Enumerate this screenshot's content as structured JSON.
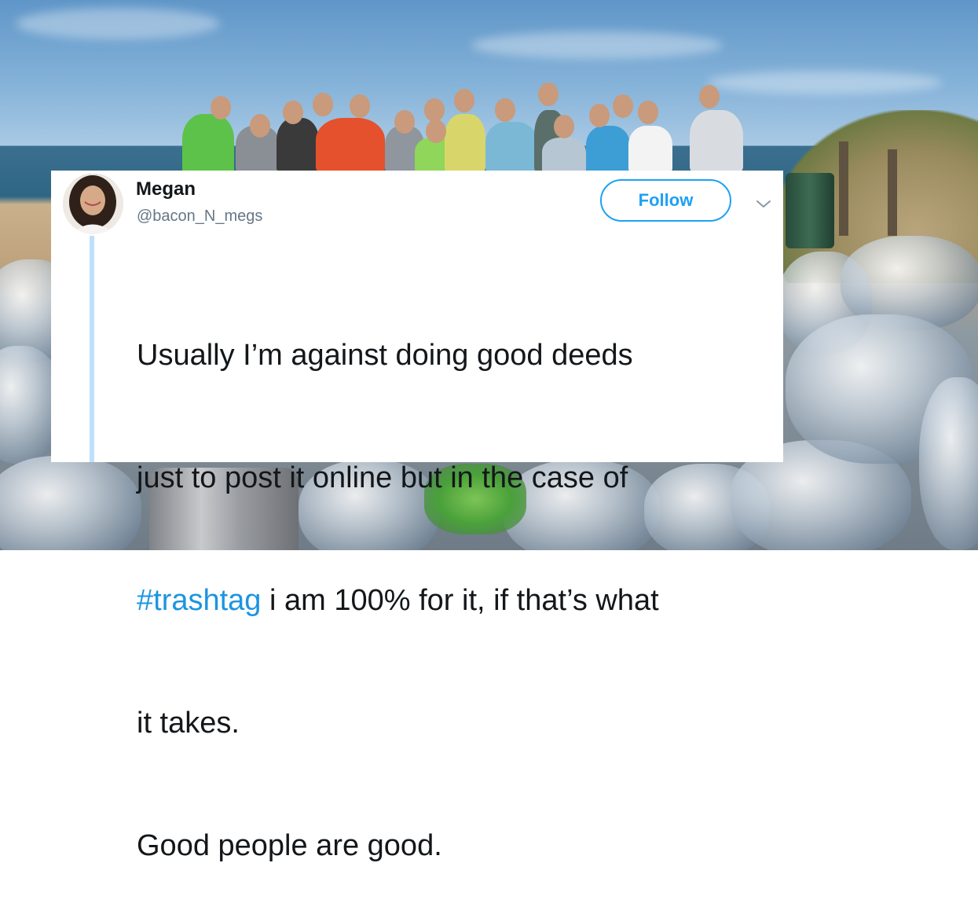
{
  "tweet": {
    "author_name": "Megan",
    "author_handle": "@bacon_N_megs",
    "follow_label": "Follow",
    "text_line1": "Usually I’m against doing good deeds",
    "text_line2": "just to post it online but in the case of",
    "hashtag": "#trashtag",
    "text_line3_rest": " i am 100% for it, if that’s what",
    "text_line4": "it takes.",
    "text_line5": "Good people are good."
  },
  "icons": {
    "more": "chevron-down-icon"
  },
  "colors": {
    "twitter_blue": "#1da1f2",
    "hashtag_blue": "#1b95e0",
    "handle_gray": "#657786",
    "text_dark": "#14171a",
    "thread_line": "#bfe0fa"
  }
}
